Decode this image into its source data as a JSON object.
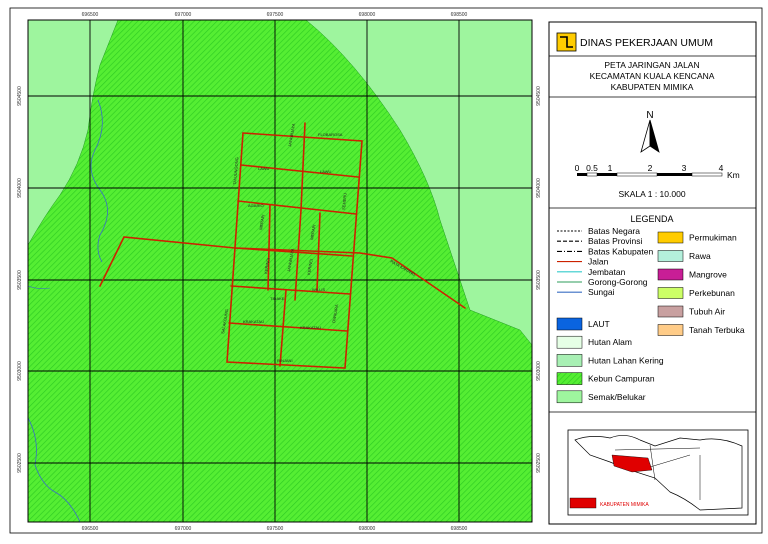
{
  "agency": "DINAS PEKERJAAN UMUM",
  "title": [
    "PETA JARINGAN JALAN",
    "KECAMATAN KUALA KENCANA",
    "KABUPATEN MIMIKA"
  ],
  "north_label": "N",
  "scale_bar": {
    "ticks": [
      "0",
      "0.5",
      "1",
      "2",
      "3",
      "4"
    ],
    "unit": "Km"
  },
  "scale_text": "SKALA 1 : 10.000",
  "legend_title": "LEGENDA",
  "legend_lines": [
    {
      "label": "Batas Negara",
      "color": "#000000",
      "style": "fine-dash"
    },
    {
      "label": "Batas Provinsi",
      "color": "#000000",
      "style": "dash"
    },
    {
      "label": "Batas Kabupaten",
      "color": "#000000",
      "style": "dash-dot"
    },
    {
      "label": "Jalan",
      "color": "#cc2200",
      "style": "solid"
    },
    {
      "label": "Jembatan",
      "color": "#33cccc",
      "style": "solid"
    },
    {
      "label": "Gorong-Gorong",
      "color": "#2e9e5b",
      "style": "solid"
    },
    {
      "label": "Sungai",
      "color": "#3a6fc4",
      "style": "solid"
    }
  ],
  "legend_fills_left": [
    {
      "label": "LAUT",
      "color": "#0a64e0"
    },
    {
      "label": "Hutan Alam",
      "color": "#e6ffe6"
    },
    {
      "label": "Hutan Lahan Kering",
      "color": "#a8f0b4"
    },
    {
      "label": "Kebun Campuran",
      "color": "#55ee33",
      "pattern": true
    },
    {
      "label": "Semak/Belukar",
      "color": "#9ef59e"
    }
  ],
  "legend_fills_right": [
    {
      "label": "Permukiman",
      "color": "#ffcc00"
    },
    {
      "label": "Rawa",
      "color": "#b4f0dc"
    },
    {
      "label": "Mangrove",
      "color": "#c81e96"
    },
    {
      "label": "Perkebunan",
      "color": "#ccff66"
    },
    {
      "label": "Tubuh Air",
      "color": "#c8a0a0"
    },
    {
      "label": "Tanah Terbuka",
      "color": "#ffcc88"
    }
  ],
  "grid_x_labels": [
    "696500",
    "697000",
    "697500",
    "698000",
    "698500"
  ],
  "grid_y_labels": [
    "9504500",
    "9504000",
    "9503500",
    "9503000",
    "9502500"
  ],
  "road_names": [
    "FLOBAROSA",
    "LAWU",
    "LAWU",
    "JAYAWIJAYA",
    "TANJUNGONG",
    "AGARIO",
    "SEMERU",
    "MERAPI",
    "MERAPI",
    "KERINCI",
    "JAYAWIJAYA",
    "KERINCI",
    "WILLIS",
    "RAYA KARANG",
    "SALAKGUNG",
    "KRAKATAU",
    "KRAKATAU",
    "TIDAKE",
    "DWIKARA",
    "RINJANI"
  ],
  "inset_label": "KABUPATEN MIMIKA",
  "colors": {
    "kebun": "#55ee33",
    "hatch": "#2ecc22",
    "semak": "#9ef59e",
    "road": "#cc2200",
    "river": "#3a6fc4",
    "inset_land": "#ffffff",
    "inset_highlight": "#e00000"
  }
}
